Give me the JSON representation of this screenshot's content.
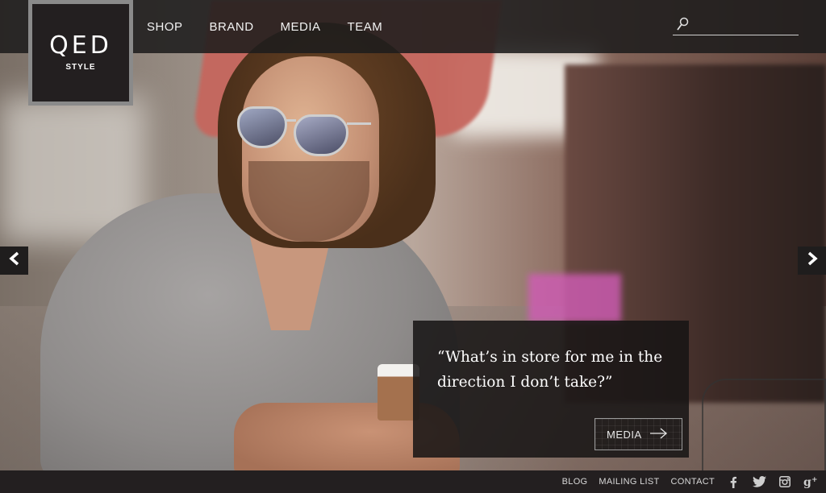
{
  "brand": {
    "name": "QED",
    "sub": "STYLE"
  },
  "nav": {
    "items": [
      {
        "label": "SHOP"
      },
      {
        "label": "BRAND"
      },
      {
        "label": "MEDIA"
      },
      {
        "label": "TEAM"
      }
    ]
  },
  "search": {
    "placeholder": "",
    "value": ""
  },
  "hero": {
    "quote": "“What’s in store for me in the direction I don’t take?”",
    "cta_label": "MEDIA"
  },
  "footer": {
    "links": [
      "BLOG",
      "MAILING LIST",
      "CONTACT"
    ],
    "social": [
      "facebook-icon",
      "twitter-icon",
      "instagram-icon",
      "google-plus-icon"
    ]
  },
  "colors": {
    "header_bg": "#1e1c1c",
    "footer_bg": "#231f20",
    "logo_border": "#8a8a8a"
  }
}
